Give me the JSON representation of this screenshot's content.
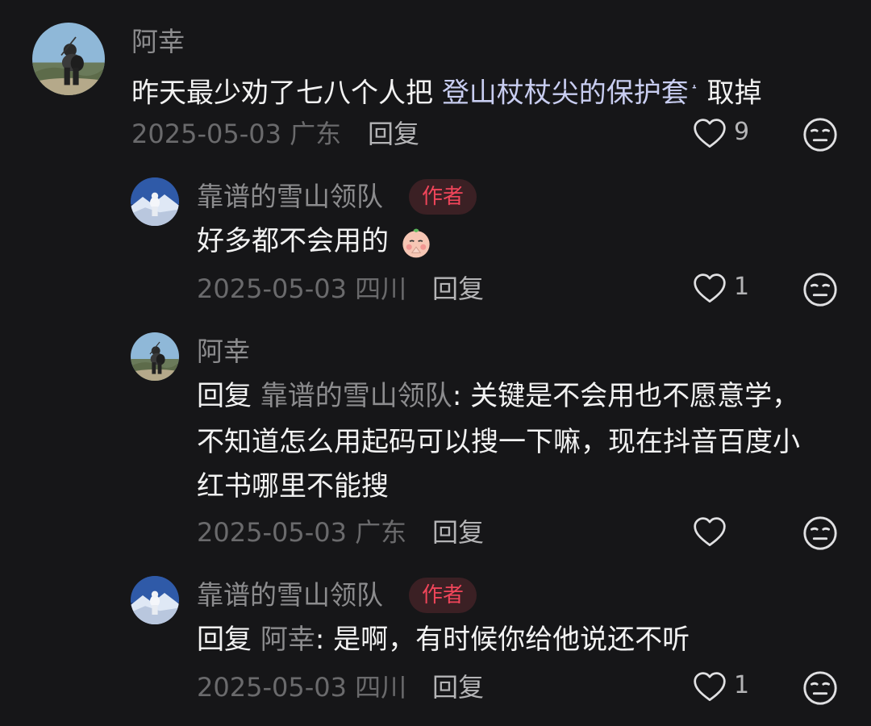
{
  "comments": [
    {
      "author": "阿幸",
      "text_before_link": "昨天最少劝了七八个人把 ",
      "link_text": "登山杖杖尖的保护套",
      "search_icon": "search-icon",
      "text_after_link": " 取掉",
      "date": "2025-05-03",
      "location": "广东",
      "reply_label": "回复",
      "likes": "9"
    },
    {
      "author": "靠谱的雪山领队",
      "author_tag": "作者",
      "text": "好多都不会用的",
      "emoji": "praying-emoji",
      "date": "2025-05-03",
      "location": "四川",
      "reply_label": "回复",
      "likes": "1"
    },
    {
      "author": "阿幸",
      "reply_prefix": "回复 ",
      "reply_target": "靠谱的雪山领队",
      "lines": [
        ": 关键是不会用也不愿意学，",
        "不知道怎么用起码可以搜一下嘛，现在抖音百度小",
        "红书哪里不能搜"
      ],
      "date": "2025-05-03",
      "location": "广东",
      "reply_label": "回复",
      "likes": ""
    },
    {
      "author": "靠谱的雪山领队",
      "author_tag": "作者",
      "reply_prefix": "回复 ",
      "reply_target": "阿幸",
      "text": ": 是啊，有时候你给他说还不听",
      "date": "2025-05-03",
      "location": "四川",
      "reply_label": "回复",
      "likes": "1"
    }
  ],
  "colors": {
    "background": "#161618",
    "author_tag_text": "#f0455a",
    "author_tag_bg": "#3b2024",
    "link": "#c8cdf0",
    "meta": "#6a6a6c"
  },
  "icons": {
    "like": "heart-outline-icon",
    "dislike": "neutral-face-icon"
  }
}
